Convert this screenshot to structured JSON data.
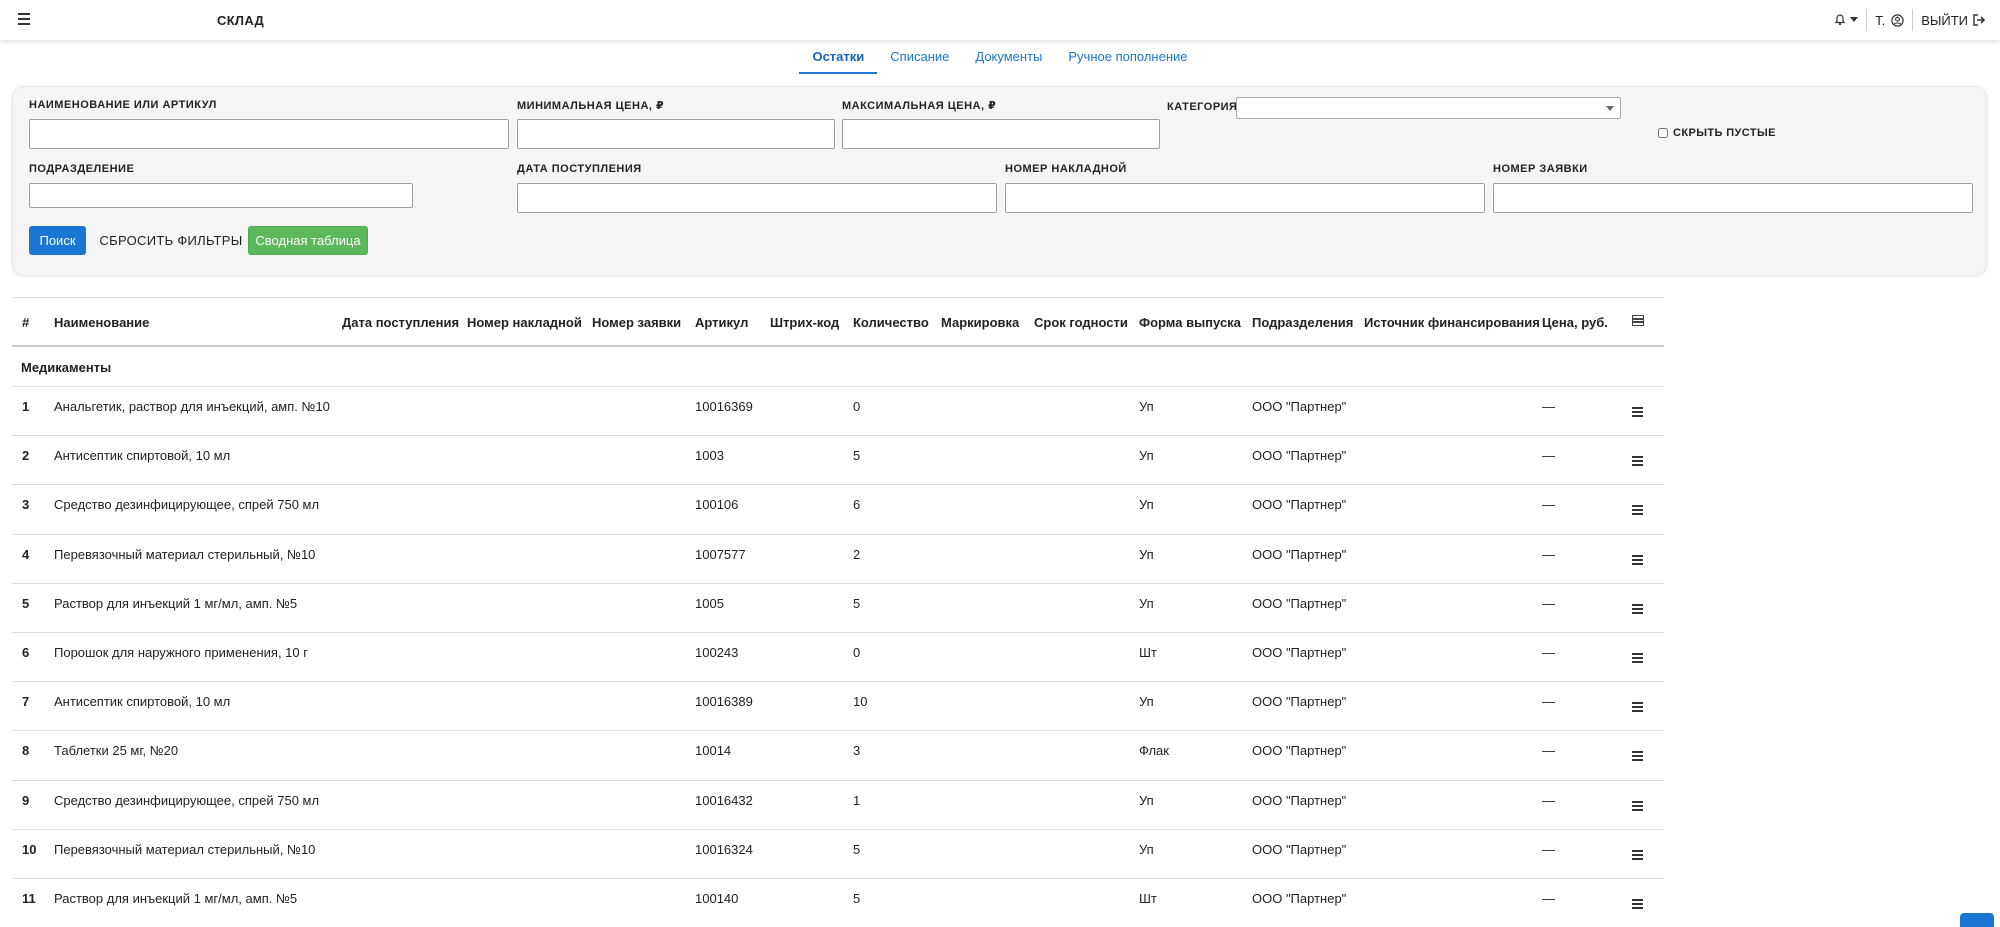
{
  "header": {
    "title": "СКЛАД",
    "user_initial": "Т.",
    "logout_label": "ВЫЙТИ"
  },
  "tabs": [
    {
      "label": "Остатки",
      "active": true
    },
    {
      "label": "Списание",
      "active": false
    },
    {
      "label": "Документы",
      "active": false
    },
    {
      "label": "Ручное пополнение",
      "active": false
    }
  ],
  "filters": {
    "name_label": "НАИМЕНОВАНИЕ ИЛИ АРТИКУЛ",
    "min_price_label": "МИНИМАЛЬНАЯ ЦЕНА, ₽",
    "max_price_label": "МАКСИМАЛЬНАЯ ЦЕНА, ₽",
    "category_label": "КАТЕГОРИЯ",
    "hide_empty_label": "СКРЫТЬ ПУСТЫЕ",
    "division_label": "ПОДРАЗДЕЛЕНИЕ",
    "date_label": "ДАТА ПОСТУПЛЕНИЯ",
    "invoice_label": "НОМЕР НАКЛАДНОЙ",
    "request_label": "НОМЕР ЗАЯВКИ",
    "name_value": "",
    "min_price_value": "",
    "max_price_value": "",
    "division_value": "",
    "date_value": "",
    "invoice_value": "",
    "request_value": ""
  },
  "buttons": {
    "search": "Поиск",
    "reset": "СБРОСИТЬ ФИЛЬТРЫ",
    "summary": "Сводная таблица"
  },
  "table": {
    "columns": [
      "#",
      "Наименование",
      "Дата поступления",
      "Номер накладной",
      "Номер заявки",
      "Артикул",
      "Штрих-код",
      "Количество",
      "Маркировка",
      "Срок годности",
      "Форма выпуска",
      "Подразделения",
      "Источник финансирования",
      "Цена, руб."
    ],
    "group": "Медикаменты",
    "rows": [
      {
        "n": "1",
        "name": "Анальгетик, раствор для инъекций, амп. №10",
        "sku": "10016369",
        "qty": "0",
        "form": "Уп",
        "division": "ООО \"Партнер\"",
        "price": "—"
      },
      {
        "n": "2",
        "name": "Антисептик спиртовой, 10 мл",
        "sku": "1003",
        "qty": "5",
        "form": "Уп",
        "division": "ООО \"Партнер\"",
        "price": "—"
      },
      {
        "n": "3",
        "name": "Средство дезинфицирующее, спрей 750 мл",
        "sku": "100106",
        "qty": "6",
        "form": "Уп",
        "division": "ООО \"Партнер\"",
        "price": "—"
      },
      {
        "n": "4",
        "name": "Перевязочный материал стерильный, №10",
        "sku": "1007577",
        "qty": "2",
        "form": "Уп",
        "division": "ООО \"Партнер\"",
        "price": "—"
      },
      {
        "n": "5",
        "name": "Раствор для инъекций 1 мг/мл, амп. №5",
        "sku": "1005",
        "qty": "5",
        "form": "Уп",
        "division": "ООО \"Партнер\"",
        "price": "—"
      },
      {
        "n": "6",
        "name": "Порошок для наружного применения, 10 г",
        "sku": "100243",
        "qty": "0",
        "form": "Шт",
        "division": "ООО \"Партнер\"",
        "price": "—"
      },
      {
        "n": "7",
        "name": "Антисептик спиртовой, 10 мл",
        "sku": "10016389",
        "qty": "10",
        "form": "Уп",
        "division": "ООО \"Партнер\"",
        "price": "—"
      },
      {
        "n": "8",
        "name": "Таблетки 25 мг, №20",
        "sku": "10014",
        "qty": "3",
        "form": "Флак",
        "division": "ООО \"Партнер\"",
        "price": "—"
      },
      {
        "n": "9",
        "name": "Средство дезинфицирующее, спрей 750 мл",
        "sku": "10016432",
        "qty": "1",
        "form": "Уп",
        "division": "ООО \"Партнер\"",
        "price": "—"
      },
      {
        "n": "10",
        "name": "Перевязочный материал стерильный, №10",
        "sku": "10016324",
        "qty": "5",
        "form": "Уп",
        "division": "ООО \"Партнер\"",
        "price": "—"
      },
      {
        "n": "11",
        "name": "Раствор для инъекций 1 мг/мл, амп. №5",
        "sku": "100140",
        "qty": "5",
        "form": "Шт",
        "division": "ООО \"Партнер\"",
        "price": "—"
      }
    ]
  },
  "colors": {
    "accent": "#1976d2",
    "success": "#5cb85c"
  },
  "icons": [
    "menu-icon",
    "bell-icon",
    "user-icon",
    "logout-icon",
    "row-menu-icon",
    "column-settings-icon"
  ]
}
